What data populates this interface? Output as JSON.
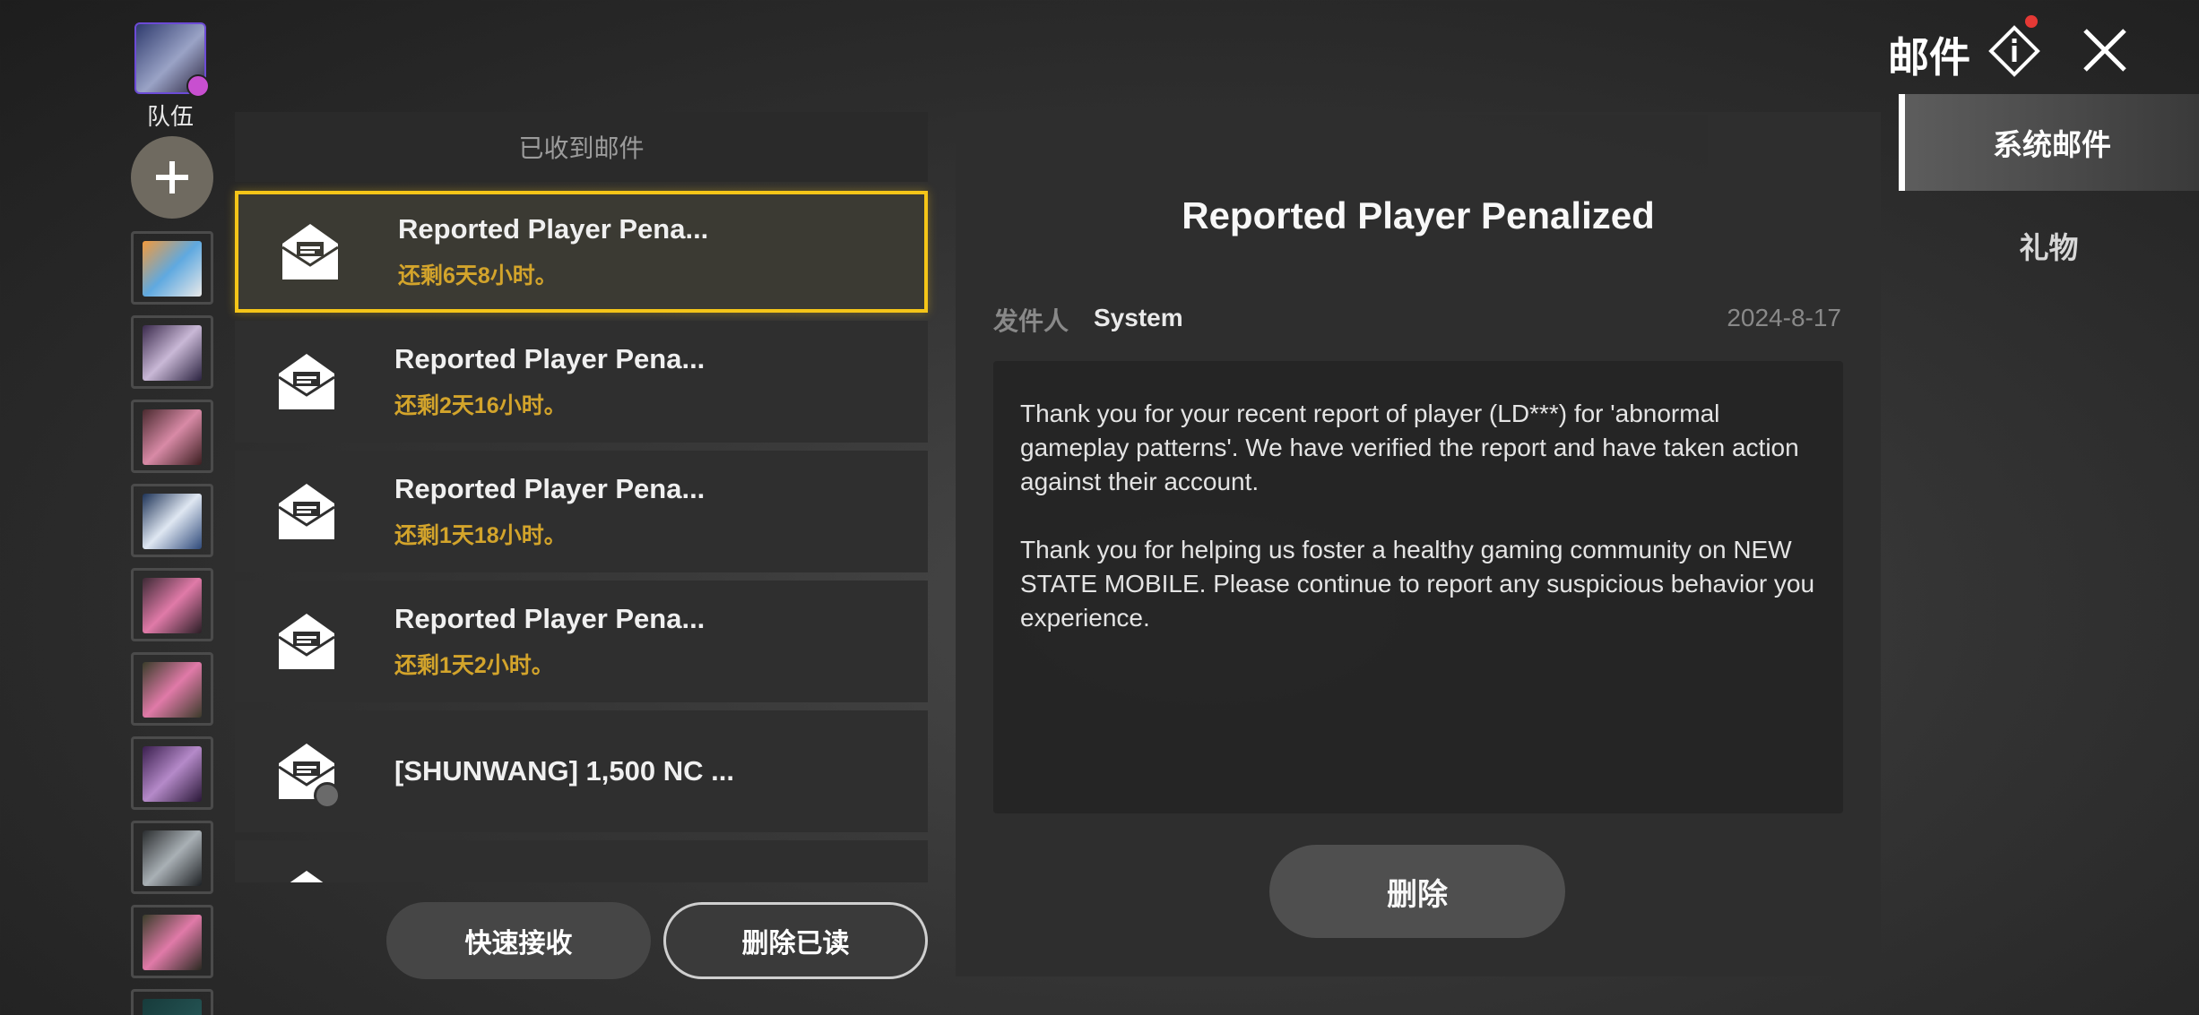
{
  "header": {
    "title": "邮件"
  },
  "sidebar": {
    "team_label": "队伍"
  },
  "list": {
    "header": "已收到邮件",
    "items": [
      {
        "title": "Reported Player Pena...",
        "remaining": "还剩6天8小时。"
      },
      {
        "title": "Reported Player Pena...",
        "remaining": "还剩2天16小时。"
      },
      {
        "title": "Reported Player Pena...",
        "remaining": "还剩1天18小时。"
      },
      {
        "title": "Reported Player Pena...",
        "remaining": "还剩1天2小时。"
      },
      {
        "title": "[SHUNWANG] 1,500 NC ...",
        "remaining": ""
      }
    ],
    "quick_receive": "快速接收",
    "delete_read": "删除已读"
  },
  "detail": {
    "title": "Reported Player Penalized",
    "sender_label": "发件人",
    "sender": "System",
    "date": "2024-8-17",
    "body_p1": "Thank you for your recent report of player (LD***) for 'abnormal gameplay patterns'. We have verified the report and have taken action against their account.",
    "body_p2": "Thank you for helping us foster a healthy gaming community on NEW STATE MOBILE. Please continue to report any suspicious behavior you experience.",
    "delete": "删除"
  },
  "tabs": {
    "system": "系统邮件",
    "gift": "礼物"
  },
  "colors": {
    "accent": "#f5c518",
    "remaining_text": "#d3a42b",
    "notify": "#e53935"
  },
  "icons": [
    "mail-open-icon",
    "info-icon",
    "close-icon",
    "plus-icon",
    "check-icon"
  ]
}
